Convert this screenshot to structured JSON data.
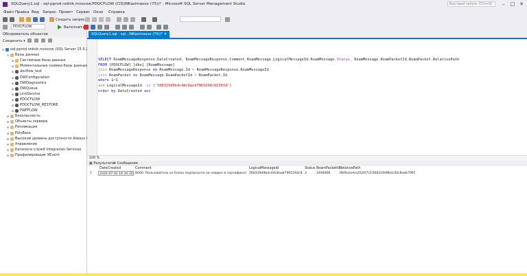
{
  "window": {
    "title": "SQLQuery1.sql - sql-pprod.rzdnik.moscow.PDOCFLOW (CIS\\INKasimasov (75))* - Microsoft SQL Server Management Studio",
    "quick_launch_placeholder": "Быстрый запуск (Ctrl+Q)"
  },
  "menu": [
    "Файл",
    "Правка",
    "Вид",
    "Запрос",
    "Проект",
    "Сервис",
    "Окно",
    "Справка"
  ],
  "toolbar": {
    "new_query": "Создать запрос",
    "database": "PDOCFLOW",
    "execute": "Выполнить"
  },
  "object_explorer": {
    "title": "Обозреватель объектов",
    "connect": "Соединить ▾",
    "nodes": [
      {
        "label": "sql-pprod.rzdnik.moscow (SQL Server 15.0.2104.1 - CIS\\INKasi",
        "level": 0,
        "icon": "srv",
        "exp": "⊟"
      },
      {
        "label": "Базы данных",
        "level": 1,
        "icon": "folder",
        "exp": "⊟"
      },
      {
        "label": "Системные базы данных",
        "level": 2,
        "icon": "folder",
        "exp": "⊞"
      },
      {
        "label": "Моментальные снимки базы данных",
        "level": 2,
        "icon": "folder",
        "exp": "⊞"
      },
      {
        "label": "docflow_test",
        "level": 2,
        "icon": "db",
        "exp": "⊞"
      },
      {
        "label": "DWConfiguration",
        "level": 2,
        "icon": "db",
        "exp": "⊞"
      },
      {
        "label": "DWDiagnostics",
        "level": 2,
        "icon": "db",
        "exp": "⊞"
      },
      {
        "label": "DWQueue",
        "level": 2,
        "icon": "db",
        "exp": "⊞"
      },
      {
        "label": "LinkService",
        "level": 2,
        "icon": "db",
        "exp": "⊞"
      },
      {
        "label": "PDOCFLOW",
        "level": 2,
        "icon": "db",
        "exp": "⊞"
      },
      {
        "label": "PDOCFLOW_RESTORE",
        "level": 2,
        "icon": "db",
        "exp": "⊞"
      },
      {
        "label": "PWFFLOW",
        "level": 2,
        "icon": "db",
        "exp": "⊞"
      },
      {
        "label": "Безопасность",
        "level": 1,
        "icon": "folder",
        "exp": "⊞"
      },
      {
        "label": "Объекты сервера",
        "level": 1,
        "icon": "folder",
        "exp": "⊞"
      },
      {
        "label": "Репликация",
        "level": 1,
        "icon": "folder",
        "exp": "⊞"
      },
      {
        "label": "PolyBase",
        "level": 1,
        "icon": "folder",
        "exp": "⊞"
      },
      {
        "label": "Высокий уровень доступности Always On",
        "level": 1,
        "icon": "folder",
        "exp": "⊞"
      },
      {
        "label": "Управление",
        "level": 1,
        "icon": "folder",
        "exp": "⊞"
      },
      {
        "label": "Каталоги служб Integration Services",
        "level": 1,
        "icon": "folder",
        "exp": "⊞"
      },
      {
        "label": "Профилировщик XEvent",
        "level": 1,
        "icon": "folder",
        "exp": "⊞"
      }
    ]
  },
  "editor": {
    "tab_label": "SQLQuery1.sql - sql...INKasimasov (75))*",
    "zoom": "100 %"
  },
  "results": {
    "tab_results": "Результаты",
    "tab_messages": "Сообщения",
    "columns": [
      "DateCreated",
      "Comment",
      "LogicalMessageId",
      "Status",
      "RoamPacketId",
      "RelativePath"
    ],
    "rows": [
      {
        "num": "1",
        "cells": [
          "2020-07-02 16:30:20.003",
          "8000: Пользователь из блока подписанта не найден в сертификате",
          "568329d9bdc44c8aeb7965264c8239fd",
          "2",
          "2494806",
          "IN\\Packets\\2020\\7\\2\\568329d9bdc44c8aeb7965264c..."
        ]
      }
    ]
  }
}
